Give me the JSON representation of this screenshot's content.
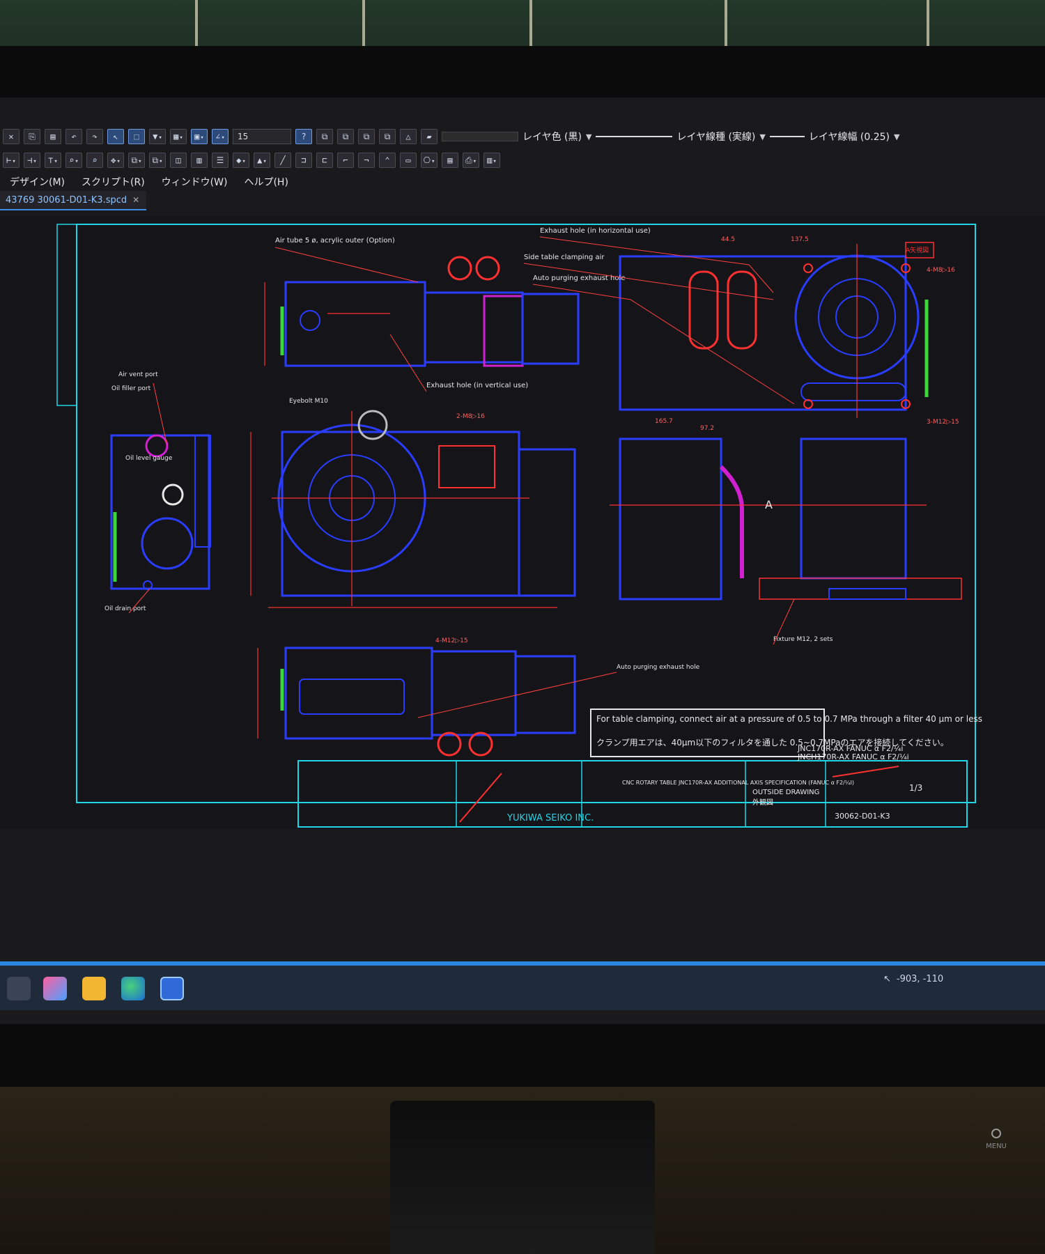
{
  "toolbar": {
    "text_size": "15",
    "layer_color": "レイヤ色 (黒)",
    "layer_linetype": "レイヤ線種 (実線)",
    "layer_lineweight": "レイヤ線幅 (0.25)"
  },
  "menu": [
    "デザイン(M)",
    "スクリプト(R)",
    "ウィンドウ(W)",
    "ヘルプ(H)"
  ],
  "document_tab": "43769 30061-D01-K3.spcd",
  "drawing": {
    "notes": {
      "air_tube": "Air tube 5 ø, acrylic outer (Option)",
      "exhaust_horizontal": "Exhaust hole (in horizontal use)",
      "side_table_clamp": "Side table clamping air",
      "auto_purging": "Auto purging exhaust hole",
      "exhaust_vertical": "Exhaust hole (in vertical use)",
      "air_vent": "Air vent port",
      "oil_filler": "Oil filler port",
      "oil_gauge": "Oil level gauge",
      "oil_drain": "Oil drain port",
      "eyebolt": "Eyebolt M10",
      "fixture": "Fixture M12, 2 sets",
      "auto_purging_bottom": "Auto purging exhaust hole",
      "clamping_note_en": "For table clamping, connect air at a pressure of 0.5 to 0.7 MPa through a filter 40 μm or less",
      "clamping_note_jp": "クランプ用エアは、40μm以下のフィルタを通した 0.5~0.7MPaのエアを接続してください。",
      "section_a": "A",
      "view_a": "A矢視図"
    },
    "dims": [
      "44.5",
      "137.5",
      "165.7",
      "97.2",
      "4-M8▷16",
      "4-M12▷15",
      "3-M12▷15",
      "2-M8▷16"
    ],
    "title_block": {
      "company": "YUKIWA SEIKO INC.",
      "product_title": "CNC ROTARY TABLE JNC170R-AX ADDITIONAL AXIS SPECIFICATION (FANUC α F2/¼I)",
      "drawing_type": "OUTSIDE DRAWING",
      "drawing_type_jp": "外観図",
      "sheet": "1/3",
      "drawing_no": "30062-D01-K3",
      "model_line1": "JNC170R-AX  FANUC α F2/¼i",
      "model_line2": "JNCH170R-AX  FANUC α F2/¼i"
    }
  },
  "status": {
    "coords": "-903, -110"
  },
  "monitor": {
    "menu_label": "MENU"
  }
}
